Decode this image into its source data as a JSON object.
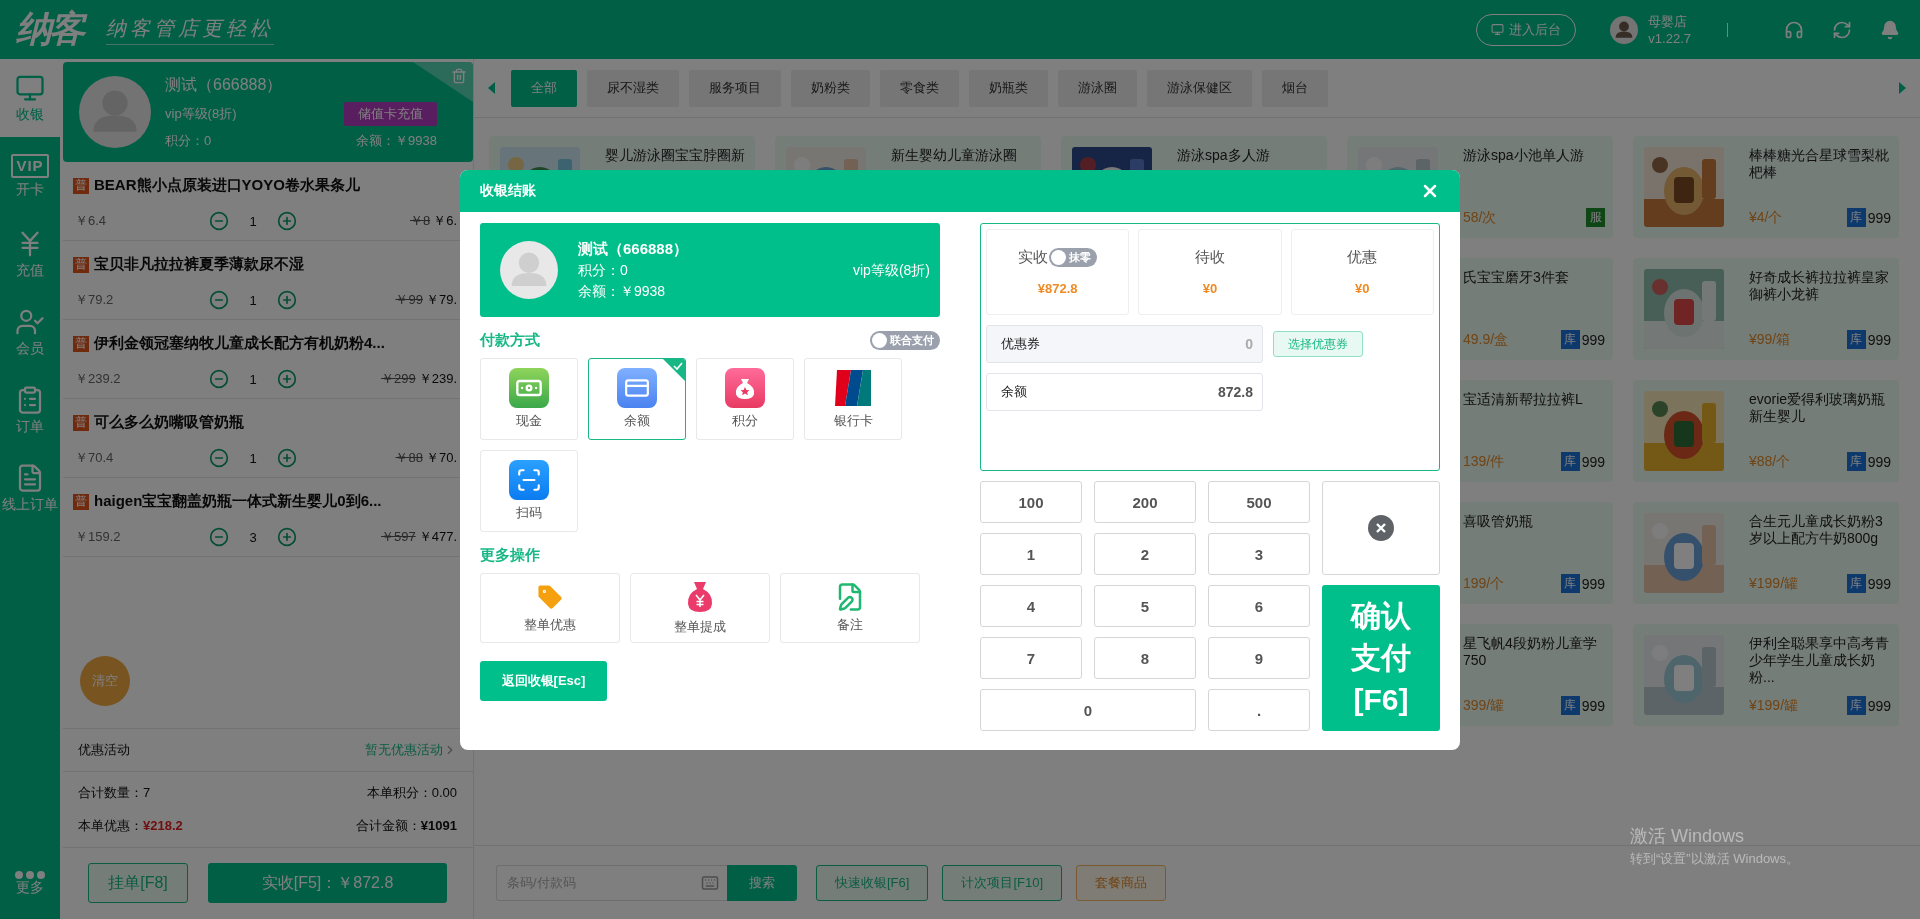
{
  "header": {
    "logo": "纳客",
    "slogan": "纳客管店更轻松",
    "admin_button": "进入后台",
    "store_name": "母婴店",
    "version": "v1.22.7"
  },
  "sidebar": {
    "items": [
      {
        "kind": "cashier",
        "label": "收银",
        "selected": true
      },
      {
        "kind": "card",
        "label": "开卡",
        "badge": "VIP",
        "selected": false
      },
      {
        "kind": "recharge",
        "label": "充值",
        "selected": false
      },
      {
        "kind": "member",
        "label": "会员",
        "selected": false
      },
      {
        "kind": "order",
        "label": "订单",
        "selected": false
      },
      {
        "kind": "online",
        "label": "线上订单",
        "selected": false
      }
    ],
    "more": "更多"
  },
  "cart": {
    "member": {
      "name": "测试（666888）",
      "vip_grade": "vip等级(8折)",
      "points": "积分：0",
      "recharge_button": "储值卡充值",
      "balance": "余额：￥9938"
    },
    "items": [
      {
        "badge": "普",
        "name": "BEAR熊小点原装进口YOYO卷水果条儿",
        "price": "￥6.4",
        "qty": "1",
        "original": "￥8",
        "total": "￥6."
      },
      {
        "badge": "普",
        "name": "宝贝非凡拉拉裤夏季薄款尿不湿",
        "price": "￥79.2",
        "qty": "1",
        "original": "￥99",
        "total": "￥79."
      },
      {
        "badge": "普",
        "name": "伊利金领冠塞纳牧儿童成长配方有机奶粉4...",
        "price": "￥239.2",
        "qty": "1",
        "original": "￥299",
        "total": "￥239."
      },
      {
        "badge": "普",
        "name": "可么多么奶嘴吸管奶瓶",
        "price": "￥70.4",
        "qty": "1",
        "original": "￥88",
        "total": "￥70."
      },
      {
        "badge": "普",
        "name": "haigen宝宝翻盖奶瓶一体式新生婴儿0到6...",
        "price": "￥159.2",
        "qty": "3",
        "original": "￥597",
        "total": "￥477."
      }
    ],
    "clear_button": "清空",
    "promo_label": "优惠活动",
    "promo_value": "暂无优惠活动",
    "total_qty": "合计数量：7",
    "order_points": "本单积分：0.00",
    "discount": {
      "label": "本单优惠：",
      "value": "¥218.2"
    },
    "total_amount": {
      "label": "合计金额：",
      "value": "¥1091"
    },
    "hold_button": "挂单[F8]",
    "pay_button": "实收[F5]：￥872.8"
  },
  "categories": [
    {
      "label": "全部",
      "selected": true
    },
    {
      "label": "尿不湿类",
      "selected": false
    },
    {
      "label": "服务项目",
      "selected": false
    },
    {
      "label": "奶粉类",
      "selected": false
    },
    {
      "label": "零食类",
      "selected": false
    },
    {
      "label": "奶瓶类",
      "selected": false
    },
    {
      "label": "游泳圈",
      "selected": false
    },
    {
      "label": "游泳保健区",
      "selected": false
    },
    {
      "label": "烟台",
      "selected": false
    }
  ],
  "product_rows": [
    [
      {
        "name": "婴儿游泳圈宝宝脖圈新"
      },
      {
        "name": "新生婴幼儿童游泳圈"
      },
      {
        "name": "游泳spa多人游"
      },
      {
        "name": "游泳spa小池单人游",
        "price": "58/次",
        "tag": {
          "kind": "service",
          "label": "服"
        }
      },
      {
        "name": "棒棒糖光合星球雪梨枇杷棒",
        "price": "¥4/个",
        "tag": {
          "kind": "stock",
          "label": "库",
          "count": "999"
        }
      }
    ],
    [
      {
        "name_lines": [
          "氏宝宝磨牙3件套"
        ],
        "price": "49.9/盒",
        "tag": {
          "kind": "stock",
          "label": "库",
          "count": "999"
        }
      },
      {
        "name": "好奇成长裤拉拉裤皇家御裤小龙裤",
        "price": "¥99/箱",
        "tag": {
          "kind": "stock",
          "label": "库",
          "count": "999"
        }
      }
    ],
    [
      {
        "name_lines": [
          "宝适清新帮拉拉裤L"
        ],
        "price": "139/件",
        "tag": {
          "kind": "stock",
          "label": "库",
          "count": "999"
        }
      },
      {
        "name": "evorie爱得利玻璃奶瓶新生婴儿",
        "price": "¥88/个",
        "tag": {
          "kind": "stock",
          "label": "库",
          "count": "999"
        }
      }
    ],
    [
      {
        "name_lines": [
          "喜吸管奶瓶"
        ],
        "price": "199/个",
        "tag": {
          "kind": "stock",
          "label": "库",
          "count": "999"
        }
      },
      {
        "name": "合生元儿童成长奶粉3岁以上配方牛奶800g",
        "price": "¥199/罐",
        "tag": {
          "kind": "stock",
          "label": "库",
          "count": "999"
        }
      }
    ],
    [
      {
        "name_lines": [
          "星飞帆4段奶粉儿童学",
          "750"
        ],
        "price": "399/罐",
        "tag": {
          "kind": "stock",
          "label": "库",
          "count": "999"
        }
      },
      {
        "name": "伊利全聪果享中高考青少年学生儿童成长奶粉...",
        "price": "¥199/罐",
        "tag": {
          "kind": "stock",
          "label": "库",
          "count": "999"
        }
      }
    ]
  ],
  "bottom_bar": {
    "search_placeholder": "条码/付款码",
    "search_button": "搜索",
    "buttons": [
      {
        "label": "快速收银[F6]",
        "kind": "primary"
      },
      {
        "label": "计次项目[F10]",
        "kind": "primary"
      },
      {
        "label": "套餐商品",
        "kind": "warning"
      }
    ]
  },
  "modal": {
    "title": "收银结账",
    "member": {
      "name": "测试（666888）",
      "points": "积分：0",
      "balance": "余额：￥9938",
      "vip_grade": "vip等级(8折)"
    },
    "payment_title": "付款方式",
    "joint_pay": {
      "label": "联合支付",
      "on": false
    },
    "methods": [
      {
        "kind": "cash",
        "label": "现金",
        "selected": false
      },
      {
        "kind": "balance",
        "label": "余额",
        "selected": true
      },
      {
        "kind": "points",
        "label": "积分",
        "selected": false
      },
      {
        "kind": "bank",
        "label": "银行卡",
        "selected": false
      },
      {
        "kind": "scan",
        "label": "扫码",
        "selected": false
      }
    ],
    "more_title": "更多操作",
    "actions": [
      {
        "kind": "discount",
        "label": "整单优惠"
      },
      {
        "kind": "commission",
        "label": "整单提成"
      },
      {
        "kind": "note",
        "label": "备注"
      }
    ],
    "back_button": "返回收银[Esc]",
    "summary": [
      {
        "label": "实收",
        "value": "¥872.8",
        "toggle": {
          "label": "抹零",
          "on": false
        }
      },
      {
        "label": "待收",
        "value": "¥0"
      },
      {
        "label": "优惠",
        "value": "¥0"
      }
    ],
    "coupon": {
      "label": "优惠券",
      "value": "0",
      "button": "选择优惠券"
    },
    "balance_field": {
      "label": "余额",
      "value": "872.8"
    },
    "keys": [
      "100",
      "200",
      "500",
      "1",
      "2",
      "3",
      "4",
      "5",
      "6",
      "7",
      "8",
      "9"
    ],
    "zero_key": "0",
    "dot_key": ".",
    "confirm_button": "确认支付[F6]"
  },
  "os_notice": {
    "title": "激活 Windows",
    "subtitle": "转到“设置”以激活 Windows。"
  }
}
